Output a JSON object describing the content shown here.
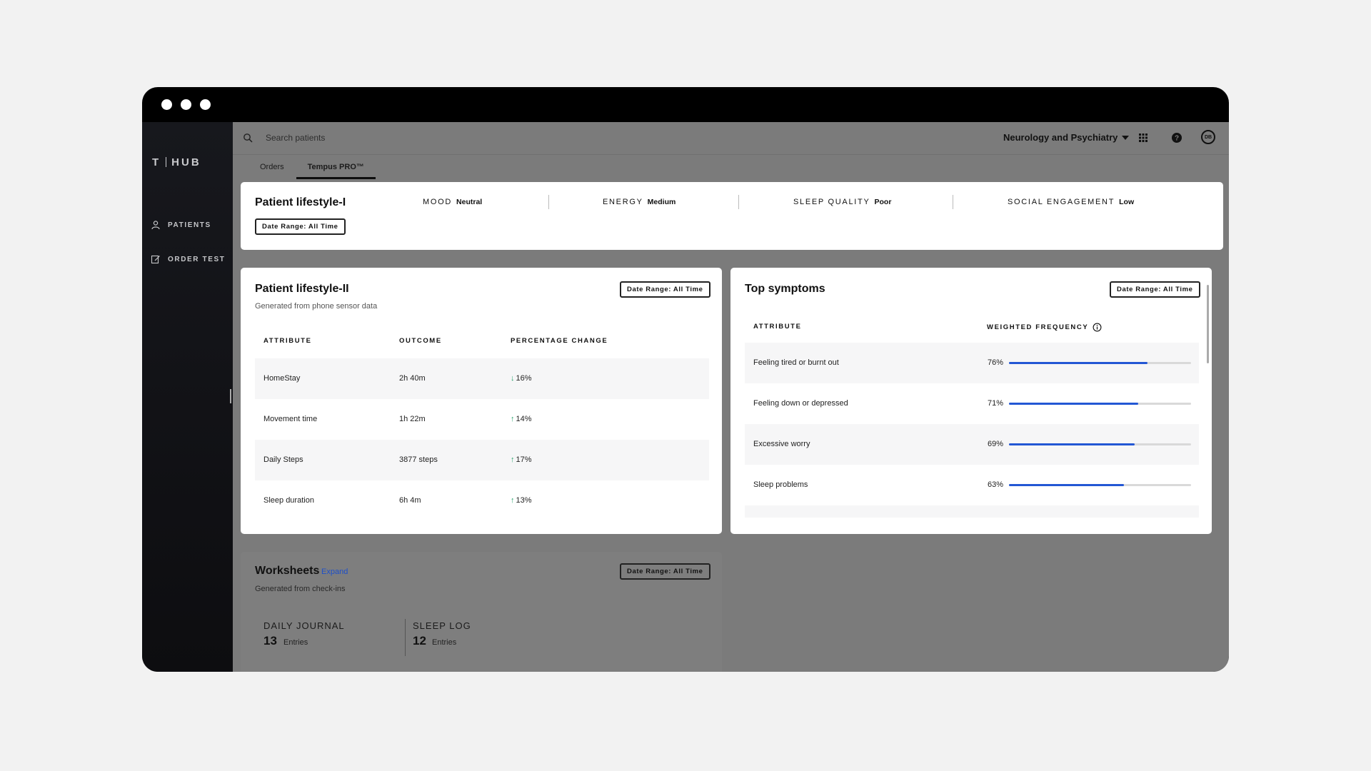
{
  "app": {
    "logo_left": "T",
    "logo_right": "HUB"
  },
  "sidebar": {
    "items": [
      {
        "label": "PATIENTS",
        "icon": "person-icon"
      },
      {
        "label": "ORDER TEST",
        "icon": "edit-icon"
      }
    ]
  },
  "topbar": {
    "search_placeholder": "Search patients",
    "department": "Neurology and Psychiatry",
    "avatar": "DB"
  },
  "tabs": [
    {
      "label": "Orders",
      "active": false
    },
    {
      "label": "Tempus PRO™",
      "active": true
    }
  ],
  "lifestyle1": {
    "title": "Patient lifestyle-I",
    "range": "Date Range: All Time",
    "metrics": [
      {
        "label": "MOOD",
        "value": "Neutral"
      },
      {
        "label": "ENERGY",
        "value": "Medium"
      },
      {
        "label": "SLEEP QUALITY",
        "value": "Poor"
      },
      {
        "label": "SOCIAL ENGAGEMENT",
        "value": "Low"
      }
    ]
  },
  "lifestyle2": {
    "title": "Patient lifestyle-II",
    "subtitle": "Generated from phone sensor data",
    "range": "Date Range: All Time",
    "columns": [
      "ATTRIBUTE",
      "OUTCOME",
      "PERCENTAGE CHANGE"
    ],
    "rows": [
      {
        "attribute": "HomeStay",
        "outcome": "2h 40m",
        "change": "16%",
        "direction": "↓"
      },
      {
        "attribute": "Movement time",
        "outcome": "1h 22m",
        "change": "14%",
        "direction": "↑"
      },
      {
        "attribute": "Daily Steps",
        "outcome": "3877 steps",
        "change": "17%",
        "direction": "↑"
      },
      {
        "attribute": "Sleep duration",
        "outcome": "6h 4m",
        "change": "13%",
        "direction": "↑"
      }
    ]
  },
  "symptoms": {
    "title": "Top symptoms",
    "range": "Date Range: All Time",
    "columns": [
      "ATTRIBUTE",
      "WEIGHTED FREQUENCY"
    ],
    "rows": [
      {
        "label": "Feeling tired or burnt out",
        "pct": "76%",
        "value": 0.76
      },
      {
        "label": "Feeling down or depressed",
        "pct": "71%",
        "value": 0.71
      },
      {
        "label": "Excessive worry",
        "pct": "69%",
        "value": 0.69
      },
      {
        "label": "Sleep problems",
        "pct": "63%",
        "value": 0.63
      }
    ]
  },
  "worksheets": {
    "title": "Worksheets",
    "expand": "Expand",
    "subtitle": "Generated from check-ins",
    "range": "Date Range: All Time",
    "items": [
      {
        "label": "DAILY JOURNAL",
        "count": "13",
        "unit": "Entries"
      },
      {
        "label": "SLEEP LOG",
        "count": "12",
        "unit": "Entries"
      }
    ]
  },
  "colors": {
    "accent": "#2357d4",
    "up": "#27a36b",
    "overlay": "#7b7b7b"
  }
}
